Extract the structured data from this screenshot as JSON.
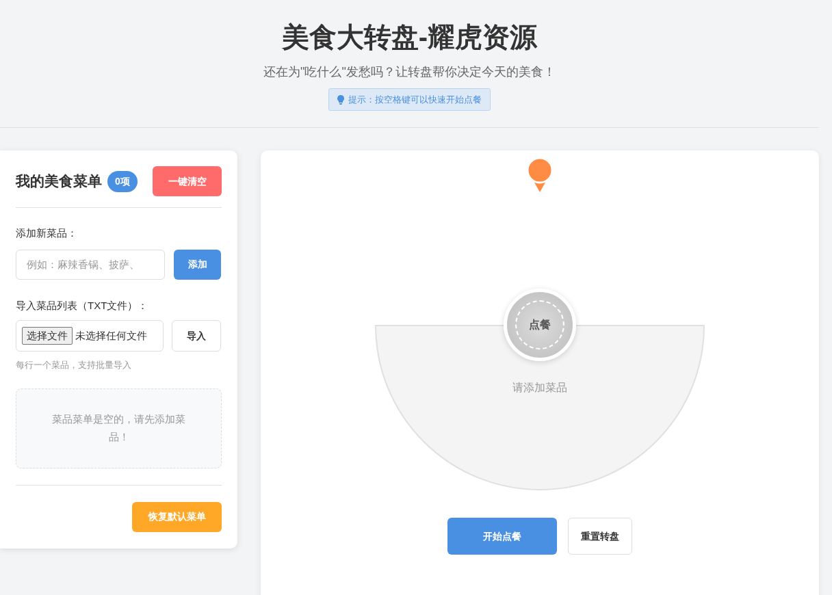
{
  "header": {
    "title": "美食大转盘-耀虎资源",
    "subtitle": "还在为\"吃什么\"发愁吗？让转盘帮你决定今天的美食！",
    "tip": "提示：按空格键可以快速开始点餐"
  },
  "menu_panel": {
    "title": "我的美食菜单",
    "count_badge": "0项",
    "clear_button": "一键清空",
    "add_label": "添加新菜品：",
    "add_placeholder": "例如：麻辣香锅、披萨、",
    "add_button": "添加",
    "import_label": "导入菜品列表（TXT文件）：",
    "file_button": "选择文件",
    "file_status": "未选择任何文件",
    "import_button": "导入",
    "import_hint": "每行一个菜品，支持批量导入",
    "empty_message": "菜品菜单是空的，请先添加菜品！",
    "restore_button": "恢复默认菜单"
  },
  "wheel": {
    "segment_label": "请添加菜品",
    "hub_label": "点餐",
    "start_button": "开始点餐",
    "reset_button": "重置转盘"
  }
}
